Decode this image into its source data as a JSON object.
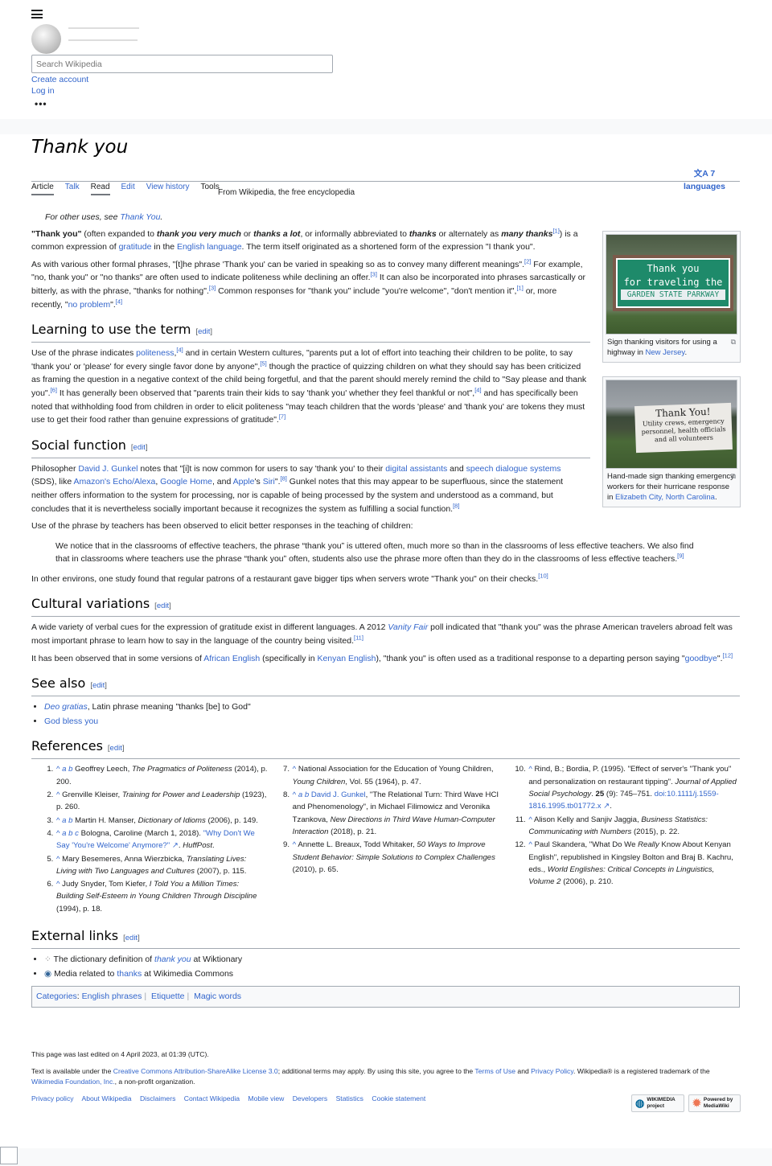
{
  "header": {
    "search_placeholder": "Search Wikipedia",
    "create_account": "Create account",
    "log_in": "Log in",
    "more": "•••"
  },
  "title": "Thank you",
  "tabs": [
    "Article",
    "Talk",
    "Read",
    "Edit",
    "View history",
    "Tools"
  ],
  "from": "From Wikipedia, the free encyclopedia",
  "languages": {
    "count": "7",
    "label": "languages"
  },
  "hatnote": [
    [
      "For other uses, see ",
      ""
    ],
    [
      "Thank You",
      "a"
    ],
    [
      ".",
      ""
    ]
  ],
  "lead": [
    [
      [
        "\"Thank you\"",
        "b"
      ],
      [
        " (often expanded to ",
        ""
      ],
      [
        "thank you very much",
        "bi"
      ],
      [
        " or ",
        ""
      ],
      [
        "thanks a lot",
        "bi"
      ],
      [
        ", or informally abbreviated to ",
        ""
      ],
      [
        "thanks",
        "bi"
      ],
      [
        " or alternately as ",
        ""
      ],
      [
        "many thanks",
        "bi"
      ],
      [
        "[1]",
        "s"
      ],
      [
        ") is a common expression of ",
        ""
      ],
      [
        "gratitude",
        "a"
      ],
      [
        " in the ",
        ""
      ],
      [
        "English language",
        "a"
      ],
      [
        ". The term itself originated as a shortened form of the expression \"I thank you\".",
        ""
      ]
    ],
    [
      [
        "As with various other formal phrases, \"[t]he phrase 'Thank you' can be varied in speaking so as to convey many different meanings\".",
        ""
      ],
      [
        "[2]",
        "s"
      ],
      [
        " For example, \"no, thank you\" or \"no thanks\" are often used to indicate politeness while declining an offer.",
        ""
      ],
      [
        "[3]",
        "s"
      ],
      [
        " It can also be incorporated into phrases sarcastically or bitterly, as with the phrase, \"thanks for nothing\".",
        ""
      ],
      [
        "[3]",
        "s"
      ],
      [
        " Common responses for \"thank you\" include \"you're welcome\", \"don't mention it\",",
        ""
      ],
      [
        "[1]",
        "s"
      ],
      [
        " or, more recently, \"",
        ""
      ],
      [
        "no problem",
        "a"
      ],
      [
        "\".",
        ""
      ],
      [
        "[4]",
        "s"
      ]
    ]
  ],
  "edit_label": "edit",
  "sections": [
    {
      "title": "Learning to use the term",
      "paras": [
        [
          [
            "Use of the phrase indicates ",
            ""
          ],
          [
            "politeness",
            "a"
          ],
          [
            ",",
            ""
          ],
          [
            "[4]",
            "s"
          ],
          [
            " and in certain Western cultures, \"parents put a lot of effort into teaching their children to be polite, to say 'thank you' or 'please' for every single favor done by anyone\",",
            ""
          ],
          [
            "[5]",
            "s"
          ],
          [
            " though the practice of quizzing children on what they should say has been criticized as framing the question in a negative context of the child being forgetful, and that the parent should merely remind the child to \"Say please and thank you\".",
            ""
          ],
          [
            "[6]",
            "s"
          ],
          [
            " It has generally been observed that \"parents train their kids to say 'thank you' whether they feel thankful or not\",",
            ""
          ],
          [
            "[4]",
            "s"
          ],
          [
            " and has specifically been noted that withholding food from children in order to elicit politeness \"may teach children that the words 'please' and 'thank you' are tokens they must use to get their food rather than genuine expressions of gratitude\".",
            ""
          ],
          [
            "[7]",
            "s"
          ]
        ]
      ]
    },
    {
      "title": "Social function",
      "paras": [
        [
          [
            "Philosopher ",
            ""
          ],
          [
            "David J. Gunkel",
            "a"
          ],
          [
            " notes that \"[i]t is now common for users to say 'thank you' to their ",
            ""
          ],
          [
            "digital assistants",
            "a"
          ],
          [
            " and ",
            ""
          ],
          [
            "speech dialogue systems",
            "a"
          ],
          [
            " (SDS), like ",
            ""
          ],
          [
            "Amazon's Echo/Alexa",
            "a"
          ],
          [
            ", ",
            ""
          ],
          [
            "Google Home",
            "a"
          ],
          [
            ", and ",
            ""
          ],
          [
            "Apple",
            "a"
          ],
          [
            "'s ",
            ""
          ],
          [
            "Siri",
            "a"
          ],
          [
            "\".",
            ""
          ],
          [
            "[8]",
            "s"
          ],
          [
            " Gunkel notes that this may appear to be superfluous, since the statement neither offers information to the system for processing, nor is capable of being processed by the system and understood as a command, but concludes that it is nevertheless socially important because it recognizes the system as fulfilling a social function.",
            ""
          ],
          [
            "[8]",
            "s"
          ]
        ],
        [
          [
            "Use of the phrase by teachers has been observed to elicit better responses in the teaching of children:",
            ""
          ]
        ]
      ],
      "quote": [
        [
          "We notice that in the classrooms of effective teachers, the phrase “thank you” is uttered often, much more so than in the classrooms of less effective teachers. We also find that in classrooms where teachers use the phrase “thank you” often, students also use the phrase more often than they do in the classrooms of less effective teachers.",
          ""
        ],
        [
          "[9]",
          "s"
        ]
      ],
      "after": [
        [
          "In other environs, one study found that regular patrons of a restaurant gave bigger tips when servers wrote \"Thank you\" on their checks.",
          ""
        ],
        [
          "[10]",
          "s"
        ]
      ]
    },
    {
      "title": "Cultural variations",
      "paras": [
        [
          [
            "A wide variety of verbal cues for the expression of gratitude exist in different languages. A 2012 ",
            ""
          ],
          [
            "Vanity Fair",
            "ai"
          ],
          [
            " poll indicated that \"thank you\" was the phrase American travelers abroad felt was most important phrase to learn how to say in the language of the country being visited.",
            ""
          ],
          [
            "[11]",
            "s"
          ]
        ],
        [
          [
            "It has been observed that in some versions of ",
            ""
          ],
          [
            "African English",
            "a"
          ],
          [
            " (specifically in ",
            ""
          ],
          [
            "Kenyan English",
            "a"
          ],
          [
            "), \"thank you\" is often used as a traditional response to a departing person saying \"",
            ""
          ],
          [
            "goodbye",
            "a"
          ],
          [
            "\".",
            ""
          ],
          [
            "[12]",
            "s"
          ]
        ]
      ]
    }
  ],
  "see_also": {
    "title": "See also",
    "items": [
      [
        [
          "Deo gratias",
          "ai"
        ],
        [
          ", Latin phrase meaning \"thanks [be] to God\"",
          ""
        ]
      ],
      [
        [
          "God bless you",
          "a"
        ]
      ]
    ]
  },
  "references": {
    "title": "References",
    "columns": [
      [
        [
          [
            "^ ",
            "a"
          ],
          [
            "a b",
            "ai"
          ],
          [
            " Geoffrey Leech, ",
            ""
          ],
          [
            "The Pragmatics of Politeness",
            "i"
          ],
          [
            " (2014), p. 200.",
            ""
          ]
        ],
        [
          [
            "^",
            "a"
          ],
          [
            " Grenville Kleiser, ",
            ""
          ],
          [
            "Training for Power and Leadership",
            "i"
          ],
          [
            " (1923), p. 260.",
            ""
          ]
        ],
        [
          [
            "^ ",
            "a"
          ],
          [
            "a b",
            "ai"
          ],
          [
            " Martin H. Manser, ",
            ""
          ],
          [
            "Dictionary of Idioms",
            "i"
          ],
          [
            " (2006), p. 149.",
            ""
          ]
        ],
        [
          [
            "^ ",
            "a"
          ],
          [
            "a b c",
            "ai"
          ],
          [
            " Bologna, Caroline (March 1, 2018). ",
            ""
          ],
          [
            "\"Why Don't We Say 'You're Welcome' Anymore?\" ↗",
            "a"
          ],
          [
            ". ",
            ""
          ],
          [
            "HuffPost",
            "i"
          ],
          [
            ".",
            ""
          ]
        ],
        [
          [
            "^",
            "a"
          ],
          [
            " Mary Besemeres, Anna Wierzbicka, ",
            ""
          ],
          [
            "Translating Lives: Living with Two Languages and Cultures",
            "i"
          ],
          [
            " (2007), p. 115.",
            ""
          ]
        ],
        [
          [
            "^",
            "a"
          ],
          [
            " Judy Snyder, Tom Kiefer, ",
            ""
          ],
          [
            "I Told You a Million Times: Building Self-Esteem in Young Children Through Discipline",
            "i"
          ],
          [
            " (1994), p. 18.",
            ""
          ]
        ]
      ],
      [
        [
          [
            "^",
            "a"
          ],
          [
            " National Association for the Education of Young Children, ",
            ""
          ],
          [
            "Young Children",
            "i"
          ],
          [
            ", Vol. 55 (1964), p. 47.",
            ""
          ]
        ],
        [
          [
            "^ ",
            "a"
          ],
          [
            "a b",
            "ai"
          ],
          [
            " ",
            ""
          ],
          [
            "David J. Gunkel",
            "a"
          ],
          [
            ", \"The Relational Turn: Third Wave HCI and Phenomenology\", in Michael Filimowicz and Veronika Tzankova, ",
            ""
          ],
          [
            "New Directions in Third Wave Human-Computer Interaction",
            "i"
          ],
          [
            " (2018), p. 21.",
            ""
          ]
        ],
        [
          [
            "^",
            "a"
          ],
          [
            " Annette L. Breaux, Todd Whitaker, ",
            ""
          ],
          [
            "50 Ways to Improve Student Behavior: Simple Solutions to Complex Challenges",
            "i"
          ],
          [
            " (2010), p. 65.",
            ""
          ]
        ]
      ],
      [
        [
          [
            "^",
            "a"
          ],
          [
            " Rind, B.; Bordia, P. (1995). \"Effect of server's \"Thank you\" and personalization on restaurant tipping\". ",
            ""
          ],
          [
            "Journal of Applied Social Psychology",
            "i"
          ],
          [
            ". ",
            ""
          ],
          [
            "25",
            "b"
          ],
          [
            " (9): 745–751. ",
            ""
          ],
          [
            "doi:10.1111/j.1559-1816.1995.tb01772.x ↗",
            "a"
          ],
          [
            ".",
            ""
          ]
        ],
        [
          [
            "^",
            "a"
          ],
          [
            " Alison Kelly and Sanjiv Jaggia, ",
            ""
          ],
          [
            "Business Statistics: Communicating with Numbers",
            "i"
          ],
          [
            " (2015), p. 22.",
            ""
          ]
        ],
        [
          [
            "^",
            "a"
          ],
          [
            " Paul Skandera, \"What Do We ",
            ""
          ],
          [
            "Really",
            "i"
          ],
          [
            " Know About Kenyan English\", republished in Kingsley Bolton and Braj B. Kachru, eds., ",
            ""
          ],
          [
            "World Englishes: Critical Concepts in Linguistics, Volume 2",
            "i"
          ],
          [
            " (2006), p. 210.",
            ""
          ]
        ]
      ]
    ]
  },
  "external_links": {
    "title": "External links",
    "items": [
      [
        [
          "The dictionary definition of ",
          ""
        ],
        [
          "thank you",
          "ai"
        ],
        [
          " at Wiktionary",
          ""
        ]
      ],
      [
        [
          "Media related to ",
          ""
        ],
        [
          "thanks",
          "a"
        ],
        [
          " at Wikimedia Commons",
          ""
        ]
      ]
    ]
  },
  "categories": {
    "label": "Categories",
    "items": [
      "English phrases",
      "Etiquette",
      "Magic words"
    ]
  },
  "figures": [
    {
      "sign_text": [
        "Thank you",
        "for traveling the",
        "GARDEN STATE PARKWAY"
      ],
      "caption": [
        [
          "Sign thanking visitors for using a highway in ",
          ""
        ],
        [
          "New Jersey",
          "a"
        ],
        [
          ".",
          ""
        ]
      ]
    },
    {
      "sign_text": [
        "Thank You!",
        "Utility crews, emergency",
        "personnel, health officials",
        "and all volunteers"
      ],
      "caption": [
        [
          "Hand-made sign thanking emergency workers for their hurricane response in ",
          ""
        ],
        [
          "Elizabeth City, North Carolina",
          "a"
        ],
        [
          ".",
          ""
        ]
      ]
    }
  ],
  "footer": {
    "last_edited": "This page was last edited on 4 April 2023, at 01:39 (UTC).",
    "license": [
      [
        "Text is available under the ",
        ""
      ],
      [
        "Creative Commons Attribution-ShareAlike License 3.0",
        "a"
      ],
      [
        "; additional terms may apply. By using this site, you agree to the ",
        ""
      ],
      [
        "Terms of Use",
        "a"
      ],
      [
        " and ",
        ""
      ],
      [
        "Privacy Policy",
        "a"
      ],
      [
        ". Wikipedia® is a registered trademark of the ",
        ""
      ],
      [
        "Wikimedia Foundation, Inc.",
        "a"
      ],
      [
        ", a non-profit organization.",
        ""
      ]
    ],
    "links": [
      "Privacy policy",
      "About Wikipedia",
      "Disclaimers",
      "Contact Wikipedia",
      "Mobile view",
      "Developers",
      "Statistics",
      "Cookie statement"
    ],
    "badges": {
      "wikimedia": "WIKIMEDIA project",
      "mediawiki": "Powered by MediaWiki"
    }
  },
  "colors": {
    "link": "#3366cc",
    "text": "#202122",
    "border": "#a2a9b1"
  }
}
